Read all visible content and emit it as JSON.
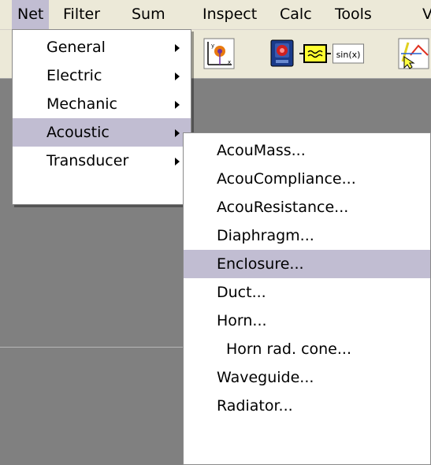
{
  "menubar": {
    "items": [
      {
        "label": "Net"
      },
      {
        "label": "Filter"
      },
      {
        "label": "Sum"
      },
      {
        "label": "Inspect"
      },
      {
        "label": "Calc"
      },
      {
        "label": "Tools"
      },
      {
        "label": "V"
      }
    ]
  },
  "toolbar": {
    "sine_label": "sin(x)"
  },
  "net_menu": {
    "items": [
      {
        "label": "General"
      },
      {
        "label": "Electric"
      },
      {
        "label": "Mechanic"
      },
      {
        "label": "Acoustic"
      },
      {
        "label": "Transducer"
      }
    ]
  },
  "acoustic_menu": {
    "items": [
      {
        "label": "AcouMass..."
      },
      {
        "label": "AcouCompliance..."
      },
      {
        "label": "AcouResistance..."
      },
      {
        "label": "Diaphragm..."
      },
      {
        "label": "Enclosure..."
      },
      {
        "label": "Duct..."
      },
      {
        "label": "Horn..."
      },
      {
        "label": "Horn rad. cone..."
      },
      {
        "label": "Waveguide..."
      },
      {
        "label": "Radiator..."
      }
    ]
  },
  "colors": {
    "menu_highlight": "#c1bdd2",
    "workspace": "#808080",
    "bar": "#ece9d8"
  }
}
